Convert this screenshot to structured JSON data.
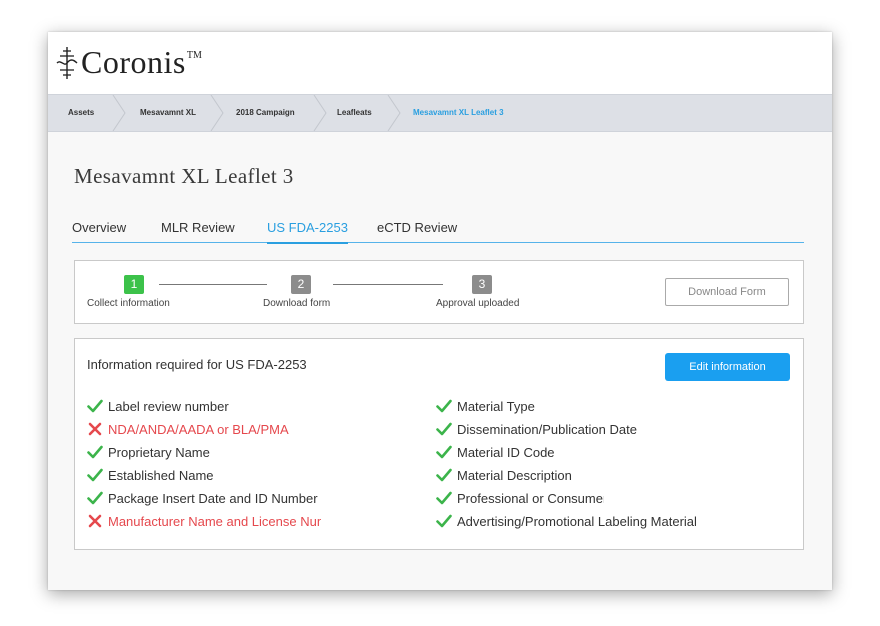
{
  "app": {
    "logo_text": "Coronis",
    "logo_tm": "TM"
  },
  "breadcrumb": [
    {
      "label": "Assets"
    },
    {
      "label": "Mesavamnt XL"
    },
    {
      "label": "2018 Campaign"
    },
    {
      "label": "Leafleats"
    },
    {
      "label": "Mesavamnt XL Leaflet 3",
      "active": true
    }
  ],
  "page": {
    "title": "Mesavamnt XL Leaflet 3"
  },
  "tabs": [
    {
      "label": "Overview"
    },
    {
      "label": "MLR Review"
    },
    {
      "label": "US FDA-2253",
      "active": true
    },
    {
      "label": "eCTD Review"
    }
  ],
  "steps": [
    {
      "num": "1",
      "label": "Collect information",
      "status": "done"
    },
    {
      "num": "2",
      "label": "Download form",
      "status": "pending"
    },
    {
      "num": "3",
      "label": "Approval uploaded",
      "status": "pending"
    }
  ],
  "buttons": {
    "download": "Download Form",
    "edit": "Edit information"
  },
  "info": {
    "title": "Information required for US FDA-2253",
    "left": [
      {
        "label": "Label review number",
        "status": "ok"
      },
      {
        "label": "NDA/ANDA/AADA or BLA/PMA",
        "status": "missing"
      },
      {
        "label": "Proprietary Name",
        "status": "ok"
      },
      {
        "label": "Established Name",
        "status": "ok"
      },
      {
        "label": "Package Insert Date and ID Number",
        "status": "ok"
      },
      {
        "label": "Manufacturer Name and License Number",
        "status": "missing"
      }
    ],
    "right": [
      {
        "label": "Material Type",
        "status": "ok"
      },
      {
        "label": "Dissemination/Publication Date",
        "status": "ok"
      },
      {
        "label": "Material ID Code",
        "status": "ok"
      },
      {
        "label": "Material Description",
        "status": "ok"
      },
      {
        "label": "Professional or Consumer",
        "status": "ok"
      },
      {
        "label": "Advertising/Promotional Labeling Material",
        "status": "ok"
      }
    ]
  },
  "colors": {
    "accent": "#2a9fe0",
    "ok": "#3cb44b",
    "missing": "#e5484d",
    "step_done": "#3cc24a"
  }
}
